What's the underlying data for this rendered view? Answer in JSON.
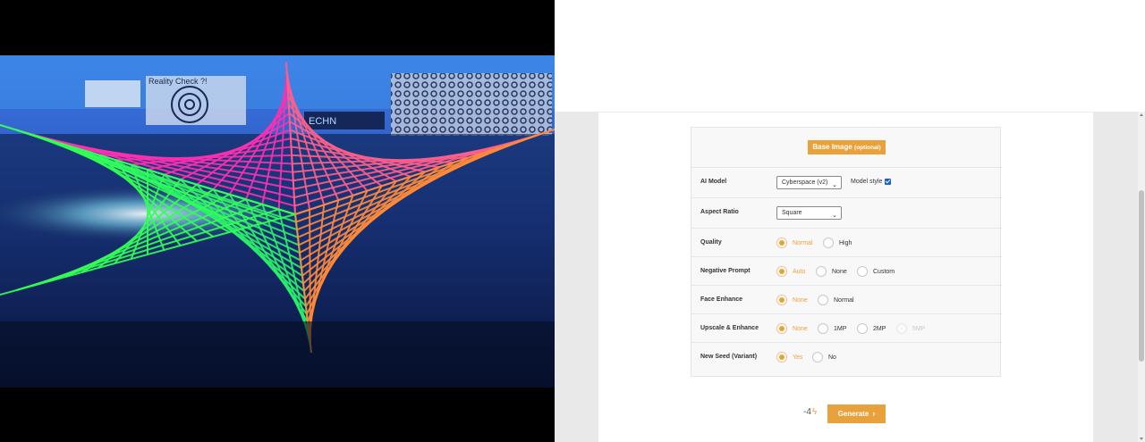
{
  "form": {
    "base_image_button": "Base Image",
    "base_image_optional": "(optional)",
    "ai_model": {
      "label": "AI Model",
      "selected": "Cyberspace (v2)",
      "model_style_label": "Model style",
      "model_style_checked": true
    },
    "aspect_ratio": {
      "label": "Aspect Ratio",
      "selected": "Square"
    },
    "quality": {
      "label": "Quality",
      "options": [
        "Normal",
        "High"
      ],
      "selected": "Normal"
    },
    "negative_prompt": {
      "label": "Negative Prompt",
      "options": [
        "Auto",
        "None",
        "Custom"
      ],
      "selected": "Auto"
    },
    "face_enhance": {
      "label": "Face Enhance",
      "options": [
        "None",
        "Normal"
      ],
      "selected": "None"
    },
    "upscale": {
      "label": "Upscale & Enhance",
      "options": [
        "None",
        "1MP",
        "2MP",
        "5MP"
      ],
      "selected": "None",
      "disabled": [
        "5MP"
      ]
    },
    "new_seed": {
      "label": "New Seed (Variant)",
      "options": [
        "Yes",
        "No"
      ],
      "selected": "Yes"
    }
  },
  "footer": {
    "cost": "-4",
    "cost_icon": "bolt-icon",
    "generate_label": "Generate"
  },
  "image": {
    "poster_text_1": "Reality Check ?!",
    "poster_text_2": "ECHN"
  },
  "colors": {
    "accent": "#e9a23b",
    "checkbox": "#1a5fd0"
  }
}
